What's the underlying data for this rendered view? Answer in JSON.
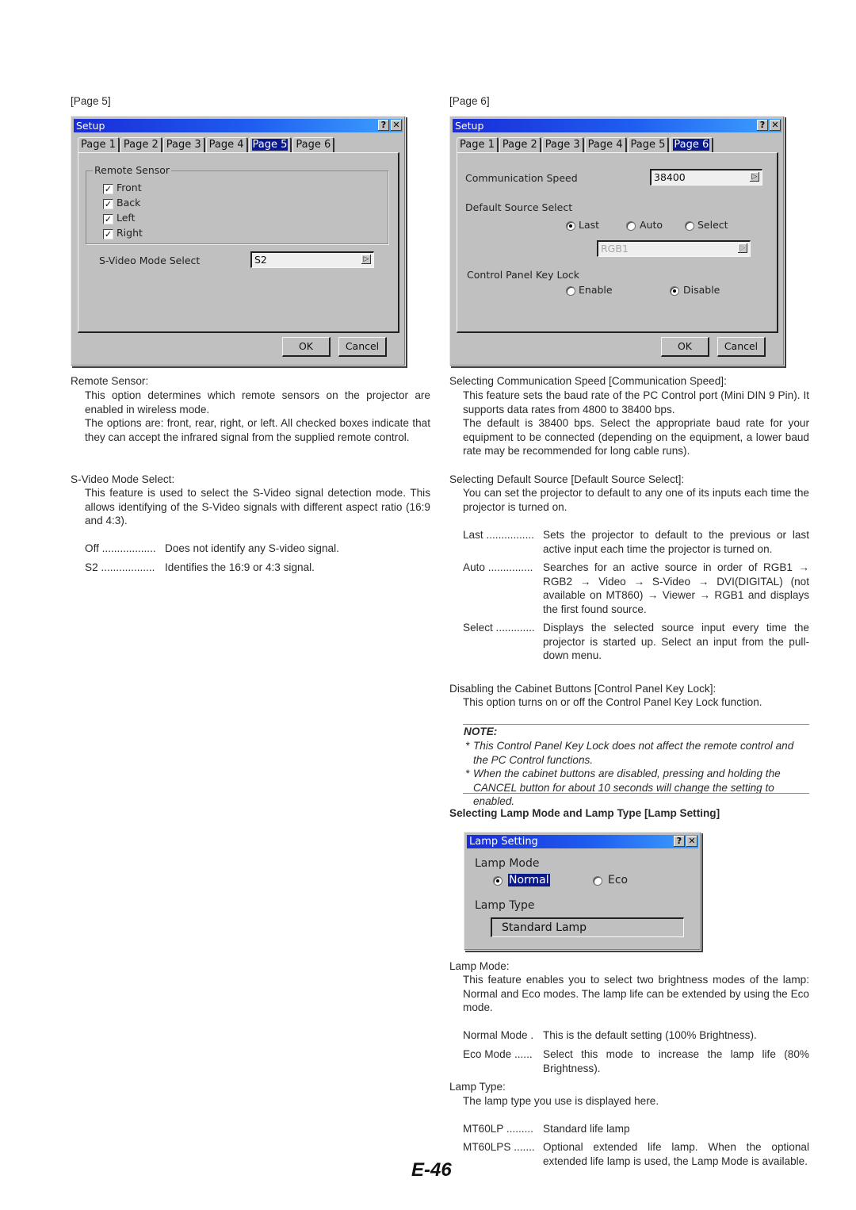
{
  "captions": {
    "left": "[Page 5]",
    "right": "[Page 6]"
  },
  "dialog_page5": {
    "title": "Setup",
    "help_icon": "?",
    "close_icon": "✕",
    "tabs": [
      "Page 1",
      "Page 2",
      "Page 3",
      "Page 4",
      "Page 5",
      "Page 6"
    ],
    "active_tab": "Page 5",
    "group_title": "Remote Sensor",
    "checkboxes": [
      {
        "label": "Front",
        "checked": true
      },
      {
        "label": "Back",
        "checked": true
      },
      {
        "label": "Left",
        "checked": true
      },
      {
        "label": "Right",
        "checked": true
      }
    ],
    "svideo_label": "S-Video Mode Select",
    "svideo_value": "S2",
    "ok": "OK",
    "cancel": "Cancel"
  },
  "dialog_page6": {
    "title": "Setup",
    "help_icon": "?",
    "close_icon": "✕",
    "tabs": [
      "Page 1",
      "Page 2",
      "Page 3",
      "Page 4",
      "Page 5",
      "Page 6"
    ],
    "active_tab": "Page 6",
    "comm_label": "Communication Speed",
    "comm_value": "38400",
    "default_source_label": "Default Source Select",
    "source_options": [
      {
        "label": "Last",
        "selected": true
      },
      {
        "label": "Auto",
        "selected": false
      },
      {
        "label": "Select",
        "selected": false
      }
    ],
    "source_combo_value": "RGB1",
    "keylock_label": "Control Panel Key Lock",
    "keylock_options": [
      {
        "label": "Enable",
        "selected": false
      },
      {
        "label": "Disable",
        "selected": true
      }
    ],
    "ok": "OK",
    "cancel": "Cancel"
  },
  "dialog_lamp": {
    "title": "Lamp Setting",
    "help_icon": "?",
    "close_icon": "✕",
    "mode_label": "Lamp Mode",
    "mode_options": [
      {
        "label": "Normal",
        "selected": true
      },
      {
        "label": "Eco",
        "selected": false
      }
    ],
    "type_label": "Lamp Type",
    "type_value": "Standard Lamp"
  },
  "left_text": {
    "remote_heading": "Remote Sensor:",
    "remote_p1": "This option determines which remote sensors on the projector are enabled in wireless mode.",
    "remote_p2": "The options are: front, rear, right, or left. All checked boxes indicate that they can accept the infrared signal from the supplied remote control.",
    "svideo_heading": "S-Video Mode Select:",
    "svideo_p1": "This feature is used to select the S-Video signal detection mode. This allows identifying of the S-Video signals with different aspect ratio (16:9 and 4:3).",
    "svideo_defs": [
      {
        "term": "Off ..................",
        "desc": "Does not identify any S-video signal."
      },
      {
        "term": "S2 ..................",
        "desc": "Identifies the 16:9 or 4:3 signal."
      }
    ]
  },
  "right_text": {
    "comm_heading": "Selecting Communication Speed [Communication Speed]:",
    "comm_p1": "This feature sets the baud rate of the PC Control port (Mini DIN 9 Pin). It supports data rates from 4800 to 38400 bps.",
    "comm_p2": "The default is 38400 bps. Select the appropriate baud rate for your equipment to be connected (depending on the equipment, a lower baud rate may be recommended for long cable runs).",
    "source_heading": "Selecting Default Source [Default Source Select]:",
    "source_p1": "You can set the projector to default to any one of its inputs each time the projector is turned on.",
    "source_defs": [
      {
        "term": "Last ................",
        "desc": "Sets the projector to default to the previous or last active input each time the projector is turned on."
      },
      {
        "term": "Auto ...............",
        "desc": "Searches for an active source in order of RGB1 → RGB2 → Video → S-Video → DVI(DIGITAL) (not available on MT860) → Viewer → RGB1 and displays the first found source."
      },
      {
        "term": "Select .............",
        "desc": "Displays the selected source input every time the projector is started up. Select an input from the pull-down menu."
      }
    ],
    "keylock_heading": "Disabling the Cabinet Buttons [Control Panel Key Lock]:",
    "keylock_p1": "This option turns on or off the Control Panel Key Lock function.",
    "note_title": "NOTE:",
    "notes": [
      "This Control Panel Key Lock does not affect the remote control and the PC Control functions.",
      "When the cabinet buttons are disabled, pressing and holding the CANCEL button for about 10 seconds will change the setting to enabled."
    ],
    "lamp_heading": "Selecting Lamp Mode and Lamp Type [Lamp Setting]",
    "lampmode_heading": "Lamp Mode:",
    "lampmode_p1": "This feature enables you to select two brightness modes of the lamp: Normal and Eco modes. The lamp life can be extended by using the Eco mode.",
    "lampmode_defs": [
      {
        "term": "Normal Mode .",
        "desc": "This is the default setting (100% Brightness)."
      },
      {
        "term": "Eco Mode ......",
        "desc": "Select this mode to increase the lamp life (80% Brightness)."
      }
    ],
    "lamptype_heading": "Lamp Type:",
    "lamptype_p1": "The lamp type you use is displayed here.",
    "lamptype_defs": [
      {
        "term": "MT60LP .........",
        "desc": "Standard life lamp"
      },
      {
        "term": "MT60LPS .......",
        "desc": "Optional extended life lamp. When the optional extended life lamp is used, the Lamp Mode is available."
      }
    ]
  },
  "page_number": "E-46"
}
